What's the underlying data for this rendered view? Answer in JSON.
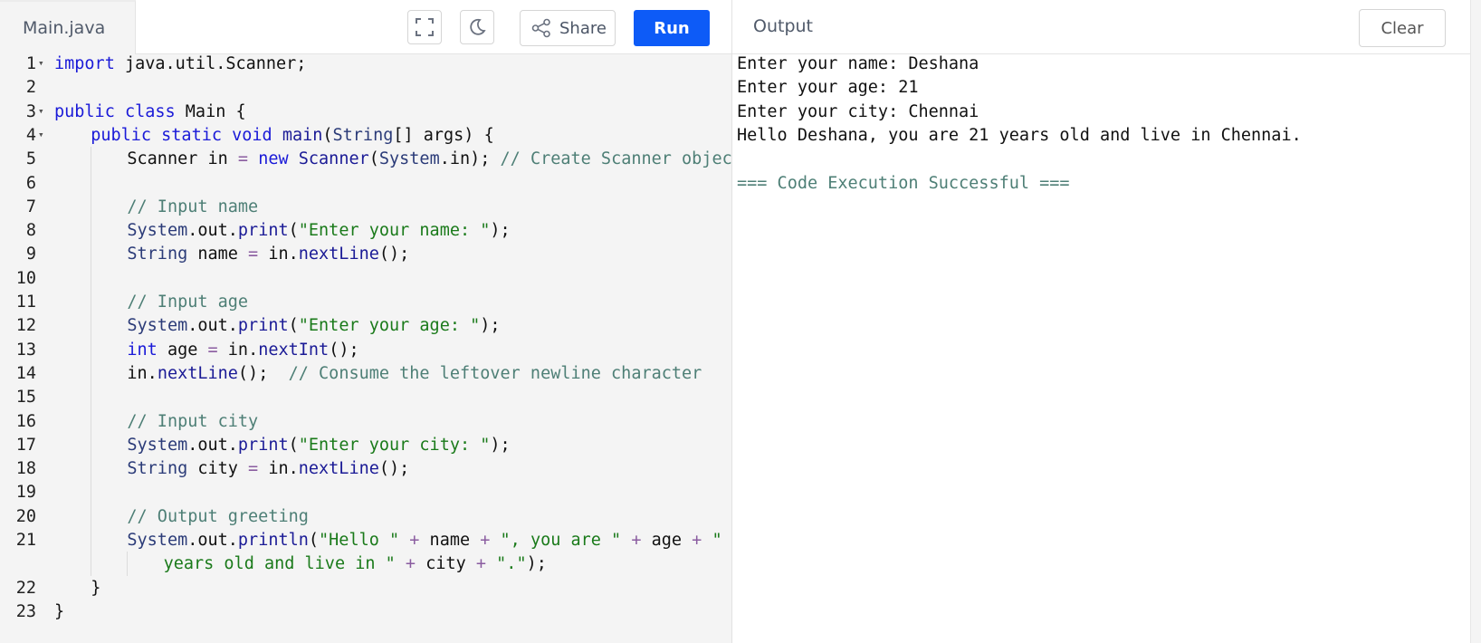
{
  "editor": {
    "file_tab": "Main.java",
    "share_label": "Share",
    "run_label": "Run",
    "icons": {
      "fullscreen": "fullscreen-icon",
      "theme": "moon-icon",
      "share": "share-icon"
    }
  },
  "code": {
    "lines": [
      {
        "num": "1",
        "fold": true,
        "indent": 0,
        "tokens": [
          [
            "kw",
            "import"
          ],
          [
            "t",
            " java.util.Scanner;"
          ]
        ]
      },
      {
        "num": "2",
        "tokens": []
      },
      {
        "num": "3",
        "fold": true,
        "indent": 0,
        "tokens": [
          [
            "kw",
            "public class"
          ],
          [
            "t",
            " Main {"
          ]
        ]
      },
      {
        "num": "4",
        "fold": true,
        "indent": 1,
        "tokens": [
          [
            "kw",
            "public static void"
          ],
          [
            "t",
            " "
          ],
          [
            "fn",
            "main"
          ],
          [
            "t",
            "("
          ],
          [
            "type",
            "String"
          ],
          [
            "t",
            "[] args) {"
          ]
        ]
      },
      {
        "num": "5",
        "indent": 2,
        "tokens": [
          [
            "t",
            "Scanner in "
          ],
          [
            "op",
            "="
          ],
          [
            "t",
            " "
          ],
          [
            "kw",
            "new"
          ],
          [
            "t",
            " "
          ],
          [
            "fn",
            "Scanner"
          ],
          [
            "t",
            "("
          ],
          [
            "type",
            "System"
          ],
          [
            "t",
            "."
          ],
          [
            "t",
            "in); "
          ],
          [
            "cmt",
            "// Create Scanner object"
          ]
        ]
      },
      {
        "num": "6",
        "indent": 2,
        "tokens": []
      },
      {
        "num": "7",
        "indent": 2,
        "tokens": [
          [
            "cmt",
            "// Input name"
          ]
        ]
      },
      {
        "num": "8",
        "indent": 2,
        "tokens": [
          [
            "type",
            "System"
          ],
          [
            "t",
            ".out."
          ],
          [
            "fn",
            "print"
          ],
          [
            "t",
            "("
          ],
          [
            "str",
            "\"Enter your name: \""
          ],
          [
            "t",
            ");"
          ]
        ]
      },
      {
        "num": "9",
        "indent": 2,
        "tokens": [
          [
            "type",
            "String"
          ],
          [
            "t",
            " name "
          ],
          [
            "op",
            "="
          ],
          [
            "t",
            " in."
          ],
          [
            "fn",
            "nextLine"
          ],
          [
            "t",
            "();"
          ]
        ]
      },
      {
        "num": "10",
        "indent": 2,
        "tokens": []
      },
      {
        "num": "11",
        "indent": 2,
        "tokens": [
          [
            "cmt",
            "// Input age"
          ]
        ]
      },
      {
        "num": "12",
        "indent": 2,
        "tokens": [
          [
            "type",
            "System"
          ],
          [
            "t",
            ".out."
          ],
          [
            "fn",
            "print"
          ],
          [
            "t",
            "("
          ],
          [
            "str",
            "\"Enter your age: \""
          ],
          [
            "t",
            ");"
          ]
        ]
      },
      {
        "num": "13",
        "indent": 2,
        "tokens": [
          [
            "kw",
            "int"
          ],
          [
            "t",
            " age "
          ],
          [
            "op",
            "="
          ],
          [
            "t",
            " in."
          ],
          [
            "fn",
            "nextInt"
          ],
          [
            "t",
            "();"
          ]
        ]
      },
      {
        "num": "14",
        "indent": 2,
        "tokens": [
          [
            "t",
            "in."
          ],
          [
            "fn",
            "nextLine"
          ],
          [
            "t",
            "();  "
          ],
          [
            "cmt",
            "// Consume the leftover newline character"
          ]
        ]
      },
      {
        "num": "15",
        "indent": 2,
        "tokens": []
      },
      {
        "num": "16",
        "indent": 2,
        "tokens": [
          [
            "cmt",
            "// Input city"
          ]
        ]
      },
      {
        "num": "17",
        "indent": 2,
        "tokens": [
          [
            "type",
            "System"
          ],
          [
            "t",
            ".out."
          ],
          [
            "fn",
            "print"
          ],
          [
            "t",
            "("
          ],
          [
            "str",
            "\"Enter your city: \""
          ],
          [
            "t",
            ");"
          ]
        ]
      },
      {
        "num": "18",
        "indent": 2,
        "tokens": [
          [
            "type",
            "String"
          ],
          [
            "t",
            " city "
          ],
          [
            "op",
            "="
          ],
          [
            "t",
            " in."
          ],
          [
            "fn",
            "nextLine"
          ],
          [
            "t",
            "();"
          ]
        ]
      },
      {
        "num": "19",
        "indent": 2,
        "tokens": []
      },
      {
        "num": "20",
        "indent": 2,
        "tokens": [
          [
            "cmt",
            "// Output greeting"
          ]
        ]
      },
      {
        "num": "21",
        "indent": 2,
        "tokens": [
          [
            "type",
            "System"
          ],
          [
            "t",
            ".out."
          ],
          [
            "fn",
            "println"
          ],
          [
            "t",
            "("
          ],
          [
            "str",
            "\"Hello \""
          ],
          [
            "t",
            " "
          ],
          [
            "op",
            "+"
          ],
          [
            "t",
            " name "
          ],
          [
            "op",
            "+"
          ],
          [
            "t",
            " "
          ],
          [
            "str",
            "\", you are \""
          ],
          [
            "t",
            " "
          ],
          [
            "op",
            "+"
          ],
          [
            "t",
            " age "
          ],
          [
            "op",
            "+"
          ],
          [
            "t",
            " "
          ],
          [
            "str",
            "\""
          ]
        ]
      },
      {
        "num": "",
        "indent": 3,
        "tokens": [
          [
            "str",
            "years old and live in \""
          ],
          [
            "t",
            " "
          ],
          [
            "op",
            "+"
          ],
          [
            "t",
            " city "
          ],
          [
            "op",
            "+"
          ],
          [
            "t",
            " "
          ],
          [
            "str",
            "\".\""
          ],
          [
            "t",
            ");"
          ]
        ]
      },
      {
        "num": "22",
        "indent": 1,
        "tokens": [
          [
            "t",
            "}"
          ]
        ]
      },
      {
        "num": "23",
        "indent": 0,
        "tokens": [
          [
            "t",
            "}"
          ]
        ]
      }
    ]
  },
  "output": {
    "title": "Output",
    "clear_label": "Clear",
    "lines": [
      {
        "text": "Enter your name: Deshana",
        "kind": "normal"
      },
      {
        "text": "Enter your age: 21",
        "kind": "normal"
      },
      {
        "text": "Enter your city: Chennai",
        "kind": "normal"
      },
      {
        "text": "Hello Deshana, you are 21 years old and live in Chennai.",
        "kind": "normal"
      },
      {
        "text": "",
        "kind": "normal"
      },
      {
        "text": "=== Code Execution Successful ===",
        "kind": "success"
      }
    ]
  },
  "colors": {
    "run_button": "#0d5bf7",
    "keyword": "#1a1ad8",
    "string": "#1a7a1a",
    "comment": "#4e7f76"
  }
}
